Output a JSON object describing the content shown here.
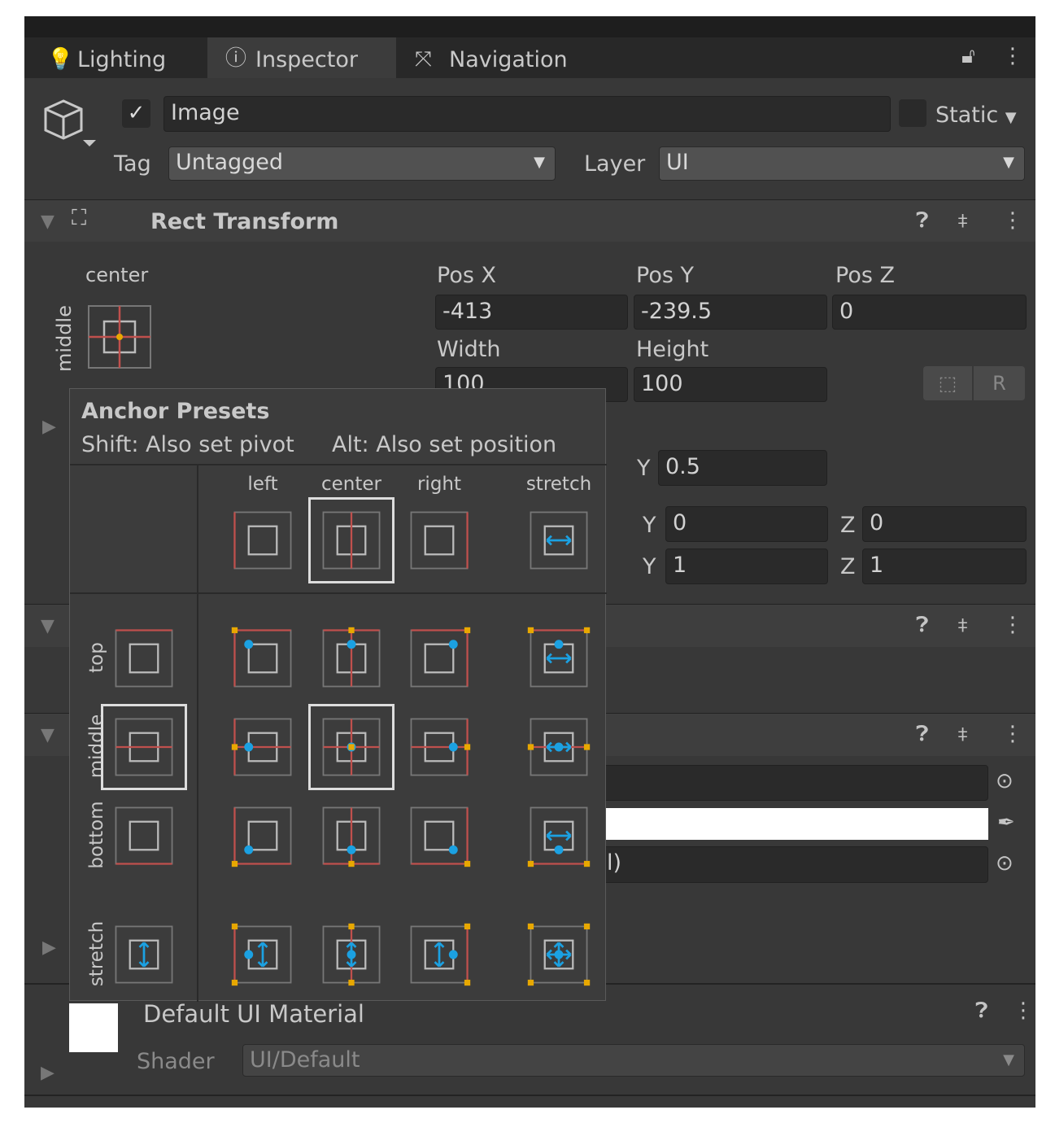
{
  "tabs": [
    {
      "label": "Lighting",
      "icon": "lightbulb-icon"
    },
    {
      "label": "Inspector",
      "icon": "info-icon",
      "active": true
    },
    {
      "label": "Navigation",
      "icon": "navigation-icon"
    }
  ],
  "object": {
    "active": true,
    "name": "Image",
    "static_label": "Static",
    "tag_label": "Tag",
    "tag_value": "Untagged",
    "layer_label": "Layer",
    "layer_value": "UI"
  },
  "rect_transform": {
    "title": "Rect Transform",
    "anchor_h": "center",
    "anchor_v": "middle",
    "pos_x_label": "Pos X",
    "pos_y_label": "Pos Y",
    "pos_z_label": "Pos Z",
    "pos_x": "-413",
    "pos_y": "-239.5",
    "pos_z": "0",
    "width_label": "Width",
    "height_label": "Height",
    "width": "100",
    "height": "100",
    "raw_button": "R",
    "y_label": "Y",
    "z_label": "Z",
    "pivot_y": "0.5",
    "rot_y": "0",
    "rot_z": "0",
    "scale_y": "1",
    "scale_z": "1"
  },
  "image": {
    "partial_text": "l)",
    "color": "#ffffff"
  },
  "material": {
    "name": "Default UI Material",
    "shader_label": "Shader",
    "shader_value": "UI/Default"
  },
  "anchor_presets": {
    "title": "Anchor Presets",
    "hint_shift": "Shift: Also set pivot",
    "hint_alt": "Alt: Also set position",
    "columns": [
      "left",
      "center",
      "right",
      "stretch"
    ],
    "rows": [
      "top",
      "middle",
      "bottom",
      "stretch"
    ],
    "selected": {
      "h": "center",
      "v": "middle"
    }
  },
  "colors": {
    "anchor_line": "#c0504d",
    "anchor_point": "#e8a800",
    "pivot": "#1ba1e2",
    "background": "#383838"
  }
}
